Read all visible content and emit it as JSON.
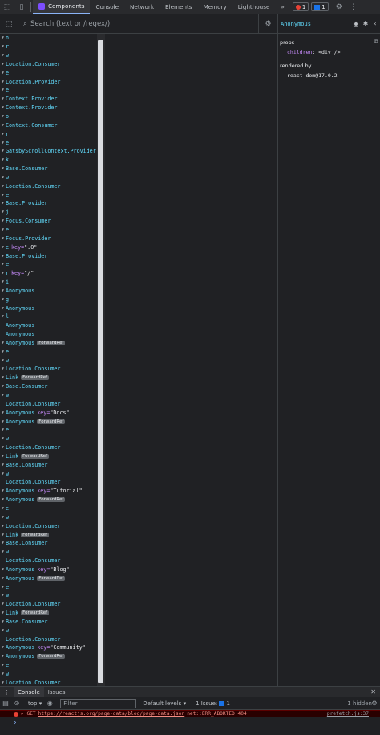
{
  "topbar": {
    "tabs": [
      {
        "label": "Components",
        "active": true
      },
      {
        "label": "Console",
        "active": false
      },
      {
        "label": "Network",
        "active": false
      },
      {
        "label": "Elements",
        "active": false
      },
      {
        "label": "Memory",
        "active": false
      },
      {
        "label": "Lighthouse",
        "active": false
      }
    ],
    "more_label": "»",
    "error_count": "1",
    "message_count": "1"
  },
  "search": {
    "placeholder": "Search (text or /regex/)"
  },
  "tree": [
    {
      "name": "n",
      "expanded": true
    },
    {
      "name": "r",
      "expanded": true
    },
    {
      "name": "w",
      "expanded": true
    },
    {
      "name": "Location.Consumer",
      "expanded": true
    },
    {
      "name": "e",
      "expanded": true
    },
    {
      "name": "Location.Provider",
      "expanded": true
    },
    {
      "name": "e",
      "expanded": true
    },
    {
      "name": "Context.Provider",
      "expanded": true
    },
    {
      "name": "Context.Provider",
      "expanded": true
    },
    {
      "name": "o",
      "expanded": true
    },
    {
      "name": "Context.Consumer",
      "expanded": true
    },
    {
      "name": "r",
      "expanded": true
    },
    {
      "name": "e",
      "expanded": true
    },
    {
      "name": "GatsbyScrollContext.Provider",
      "expanded": true
    },
    {
      "name": "k",
      "expanded": true
    },
    {
      "name": "Base.Consumer",
      "expanded": true
    },
    {
      "name": "w",
      "expanded": true
    },
    {
      "name": "Location.Consumer",
      "expanded": true
    },
    {
      "name": "e",
      "expanded": true
    },
    {
      "name": "Base.Provider",
      "expanded": true
    },
    {
      "name": "j",
      "expanded": true
    },
    {
      "name": "Focus.Consumer",
      "expanded": true
    },
    {
      "name": "e",
      "expanded": true
    },
    {
      "name": "Focus.Provider",
      "expanded": true
    },
    {
      "name": "e",
      "key": "\".0\"",
      "expanded": true
    },
    {
      "name": "Base.Provider",
      "expanded": true
    },
    {
      "name": "e",
      "expanded": true
    },
    {
      "name": "r",
      "key": "\"/\"",
      "expanded": true
    },
    {
      "name": "i",
      "expanded": true
    },
    {
      "name": "Anonymous",
      "expanded": true
    },
    {
      "name": "g",
      "expanded": true
    },
    {
      "name": "Anonymous",
      "expanded": true
    },
    {
      "name": "l",
      "expanded": true
    },
    {
      "name": "Anonymous",
      "expanded": false
    },
    {
      "name": "Anonymous",
      "expanded": false
    },
    {
      "name": "Anonymous",
      "badge": "ForwardRef",
      "expanded": true
    },
    {
      "name": "e",
      "expanded": true
    },
    {
      "name": "w",
      "expanded": true
    },
    {
      "name": "Location.Consumer",
      "expanded": true
    },
    {
      "name": "Link",
      "badge": "ForwardRef",
      "expanded": true
    },
    {
      "name": "Base.Consumer",
      "expanded": true
    },
    {
      "name": "w",
      "expanded": true
    },
    {
      "name": "Location.Consumer",
      "expanded": false
    },
    {
      "name": "Anonymous",
      "key": "\"Docs\"",
      "expanded": true
    },
    {
      "name": "Anonymous",
      "badge": "ForwardRef",
      "expanded": true
    },
    {
      "name": "e",
      "expanded": true
    },
    {
      "name": "w",
      "expanded": true
    },
    {
      "name": "Location.Consumer",
      "expanded": true
    },
    {
      "name": "Link",
      "badge": "ForwardRef",
      "expanded": true
    },
    {
      "name": "Base.Consumer",
      "expanded": true
    },
    {
      "name": "w",
      "expanded": true
    },
    {
      "name": "Location.Consumer",
      "expanded": false
    },
    {
      "name": "Anonymous",
      "key": "\"Tutorial\"",
      "expanded": true
    },
    {
      "name": "Anonymous",
      "badge": "ForwardRef",
      "expanded": true
    },
    {
      "name": "e",
      "expanded": true
    },
    {
      "name": "w",
      "expanded": true
    },
    {
      "name": "Location.Consumer",
      "expanded": true
    },
    {
      "name": "Link",
      "badge": "ForwardRef",
      "expanded": true
    },
    {
      "name": "Base.Consumer",
      "expanded": true
    },
    {
      "name": "w",
      "expanded": true
    },
    {
      "name": "Location.Consumer",
      "expanded": false
    },
    {
      "name": "Anonymous",
      "key": "\"Blog\"",
      "expanded": true
    },
    {
      "name": "Anonymous",
      "badge": "ForwardRef",
      "expanded": true
    },
    {
      "name": "e",
      "expanded": true
    },
    {
      "name": "w",
      "expanded": true
    },
    {
      "name": "Location.Consumer",
      "expanded": true
    },
    {
      "name": "Link",
      "badge": "ForwardRef",
      "expanded": true
    },
    {
      "name": "Base.Consumer",
      "expanded": true
    },
    {
      "name": "w",
      "expanded": true
    },
    {
      "name": "Location.Consumer",
      "expanded": false
    },
    {
      "name": "Anonymous",
      "key": "\"Community\"",
      "expanded": true
    },
    {
      "name": "Anonymous",
      "badge": "ForwardRef",
      "expanded": true
    },
    {
      "name": "e",
      "expanded": true
    },
    {
      "name": "w",
      "expanded": true
    },
    {
      "name": "Location.Consumer",
      "expanded": true
    }
  ],
  "details": {
    "component_name": "Anonymous",
    "props_title": "props",
    "prop_key": "children",
    "prop_value": "<div />",
    "rendered_by_title": "rendered by",
    "rendered_by_value": "react-dom@17.0.2"
  },
  "drawer": {
    "tabs": [
      {
        "label": "Console",
        "active": true
      },
      {
        "label": "Issues",
        "active": false
      }
    ],
    "context": "top",
    "filter_placeholder": "Filter",
    "levels_label": "Default levels",
    "issues_label": "1 Issue:",
    "issues_count": "1",
    "hidden_label": "1 hidden"
  },
  "console_error": {
    "method": "GET",
    "url": "https://reactjs.org/page-data/blog/page-data.json",
    "message": "net::ERR_ABORTED 404",
    "source": "prefetch.js:37"
  },
  "colors": {
    "component_name": "#61dafb",
    "key_attr": "#c58af9",
    "error_bg": "#290000",
    "active_tab_accent": "#8ab4f8"
  }
}
